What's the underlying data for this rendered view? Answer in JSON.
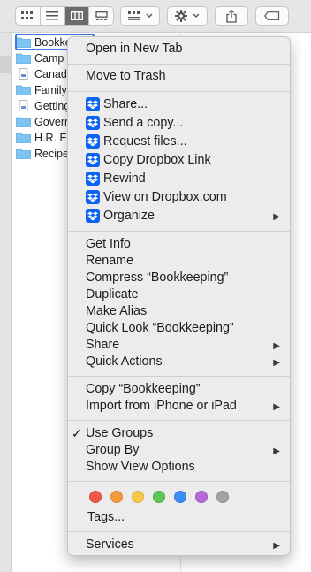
{
  "toolbar": {
    "view_buttons": [
      {
        "icon": "icon-view-icon",
        "active": false
      },
      {
        "icon": "list-view-icon",
        "active": false
      },
      {
        "icon": "column-view-icon",
        "active": true
      },
      {
        "icon": "gallery-view-icon",
        "active": false
      }
    ],
    "group_button_icon": "group-grid-icon",
    "action_button_icon": "gear-icon",
    "share_button_icon": "share-icon",
    "tag_button_icon": "tag-icon"
  },
  "files": [
    {
      "name": "Bookke",
      "type": "folder",
      "selected": true
    },
    {
      "name": "Camp",
      "type": "folder",
      "selected": false
    },
    {
      "name": "Canad",
      "type": "document",
      "selected": false
    },
    {
      "name": "Family",
      "type": "folder",
      "selected": false
    },
    {
      "name": "Getting",
      "type": "document",
      "selected": false
    },
    {
      "name": "Goverr",
      "type": "folder",
      "selected": false
    },
    {
      "name": "H.R. Ex",
      "type": "folder",
      "selected": false
    },
    {
      "name": "Recipe",
      "type": "folder",
      "selected": false
    }
  ],
  "menu": {
    "open_new_tab": "Open in New Tab",
    "move_to_trash": "Move to Trash",
    "dropbox": {
      "share": "Share...",
      "send_copy": "Send a copy...",
      "request_files": "Request files...",
      "copy_link": "Copy Dropbox Link",
      "rewind": "Rewind",
      "view_on_dropbox": "View on Dropbox.com",
      "organize": "Organize"
    },
    "get_info": "Get Info",
    "rename": "Rename",
    "compress": "Compress “Bookkeeping”",
    "duplicate": "Duplicate",
    "make_alias": "Make Alias",
    "quick_look": "Quick Look “Bookkeeping”",
    "share": "Share",
    "quick_actions": "Quick Actions",
    "copy_item": "Copy “Bookkeeping”",
    "import_iphone": "Import from iPhone or iPad",
    "use_groups": "Use Groups",
    "use_groups_checked": true,
    "group_by": "Group By",
    "show_view_options": "Show View Options",
    "tags_label": "Tags...",
    "services": "Services",
    "tag_colors": [
      {
        "name": "red",
        "hex": "#f0584d"
      },
      {
        "name": "orange",
        "hex": "#f59b3f"
      },
      {
        "name": "yellow",
        "hex": "#f5c84a"
      },
      {
        "name": "green",
        "hex": "#5ec655"
      },
      {
        "name": "blue",
        "hex": "#3c8ff5"
      },
      {
        "name": "purple",
        "hex": "#b769d9"
      },
      {
        "name": "gray",
        "hex": "#a3a3a3"
      }
    ]
  }
}
